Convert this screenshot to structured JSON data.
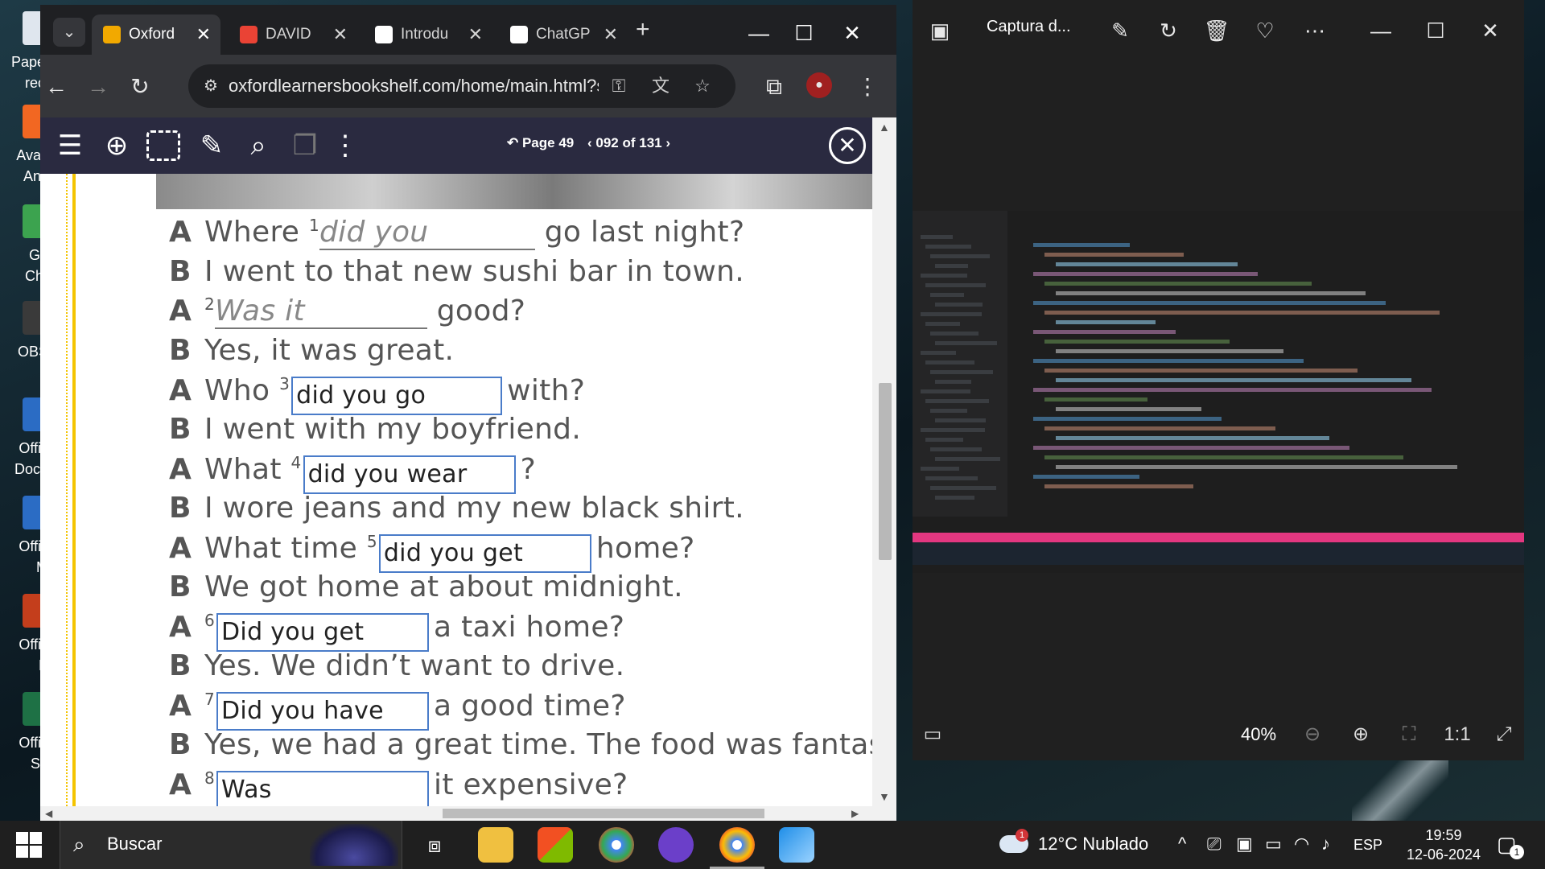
{
  "desktop": {
    "icons": [
      {
        "label": "Papel\nreci",
        "color": "#dfe6ee"
      },
      {
        "label": "Avas\nAnti",
        "color": "#f26722"
      },
      {
        "label": "Go\nChr",
        "color": "#3ca34f"
      },
      {
        "label": "OBS",
        "color": "#3a3a3a"
      },
      {
        "label": "Offic\nDocu",
        "color": "#2b6cc4"
      },
      {
        "label": "Offic\nM",
        "color": "#2b6cc4"
      },
      {
        "label": "Offic\nP",
        "color": "#c43e1c"
      },
      {
        "label": "Offic\nSh",
        "color": "#1e7145"
      }
    ]
  },
  "browser": {
    "tabs": [
      {
        "title": "Oxford",
        "active": true,
        "favicon": "oxford-icon",
        "color": "#f2a900"
      },
      {
        "title": "DAVID",
        "active": false,
        "favicon": "gmail-icon",
        "color": "#ea4335"
      },
      {
        "title": "Introdu",
        "active": false,
        "favicon": "openai-icon",
        "color": "#ffffff"
      },
      {
        "title": "ChatGP",
        "active": false,
        "favicon": "openai-icon",
        "color": "#ffffff"
      }
    ],
    "url": "oxfordlearnersbookshelf.com/home/main.html?s..."
  },
  "reader": {
    "page_label": "Page 49",
    "page_counter": "092 of 131"
  },
  "exercise": {
    "lines": [
      {
        "speaker": "A",
        "num": "1",
        "before": "Where ",
        "filled": "did you",
        "after": " go last night?"
      },
      {
        "speaker": "B",
        "text": "I went to that new sushi bar in town."
      },
      {
        "speaker": "A",
        "num": "2",
        "before": "",
        "filled": "Was it",
        "after": " good?"
      },
      {
        "speaker": "B",
        "text": "Yes, it was great."
      },
      {
        "speaker": "A",
        "num": "3",
        "before": "Who ",
        "answer": "did you go",
        "after": "with?"
      },
      {
        "speaker": "B",
        "text": "I went with my boyfriend."
      },
      {
        "speaker": "A",
        "num": "4",
        "before": "What ",
        "answer": "did you wear",
        "after": "?"
      },
      {
        "speaker": "B",
        "text": "I wore jeans and my new black shirt."
      },
      {
        "speaker": "A",
        "num": "5",
        "before": "What time ",
        "answer": "did you get",
        "after": "home?"
      },
      {
        "speaker": "B",
        "text": "We got home at about midnight."
      },
      {
        "speaker": "A",
        "num": "6",
        "before": "",
        "answer": "Did you get",
        "after": "a taxi home?"
      },
      {
        "speaker": "B",
        "text": "Yes. We didn’t want to drive."
      },
      {
        "speaker": "A",
        "num": "7",
        "before": "",
        "answer": "Did you have",
        "after": "a good time?"
      },
      {
        "speaker": "B",
        "text": "Yes, we had a great time. The food was fantastic!"
      },
      {
        "speaker": "A",
        "num": "8",
        "before": "",
        "answer": "Was",
        "after": "it expensive?"
      }
    ]
  },
  "viewer": {
    "title": "Captura d...",
    "zoom": "40%"
  },
  "taskbar": {
    "search_placeholder": "Buscar",
    "weather": "12°C  Nublado",
    "weather_badge": "1",
    "language": "ESP",
    "time": "19:59",
    "date": "12-06-2024",
    "notifications": "1"
  }
}
